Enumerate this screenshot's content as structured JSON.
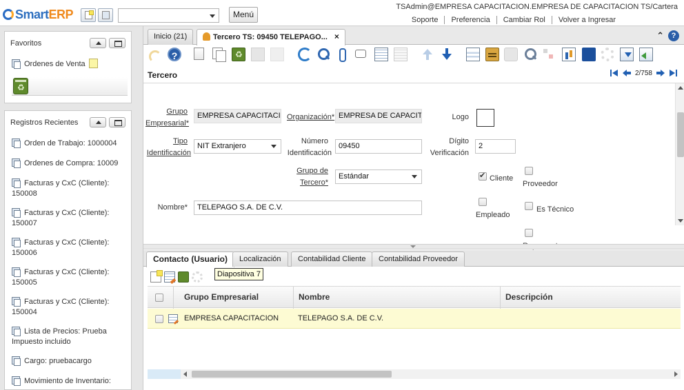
{
  "app": {
    "brand_prefix": "Smart",
    "brand_suffix": "ERP",
    "menu_label": "Menú",
    "combo_value": ""
  },
  "user": {
    "line": "TSAdmin@EMPRESA CAPACITACION.EMPRESA DE CAPACITACION TS/Cartera",
    "links": [
      "Soporte",
      "Preferencia",
      "Cambiar Rol",
      "Volver a Ingresar"
    ]
  },
  "favorites": {
    "title": "Favoritos",
    "items": [
      "Ordenes de Venta"
    ]
  },
  "recent": {
    "title": "Registros Recientes",
    "items": [
      "Orden de Trabajo: 1000004",
      "Ordenes de Compra: 10009",
      "Facturas y CxC (Cliente): 150008",
      "Facturas y CxC (Cliente): 150007",
      "Facturas y CxC (Cliente): 150006",
      "Facturas y CxC (Cliente): 150005",
      "Facturas y CxC (Cliente): 150004",
      "Lista de Precios: Prueba Impuesto incluido",
      "Cargo: pruebacargo",
      "Movimiento de Inventario:"
    ]
  },
  "window_tabs": [
    {
      "label": "Inicio (21)"
    },
    {
      "label": "Tercero TS: 09450 TELEPAGO...",
      "close": "×"
    }
  ],
  "form": {
    "title": "Tercero",
    "record_counter": "2/758",
    "labels": {
      "grupo_empresarial_1": "Grupo",
      "grupo_empresarial_2": "Empresarial*",
      "organizacion": "Organización*",
      "logo": "Logo",
      "tipo_id_1": "Tipo",
      "tipo_id_2": "Identificación",
      "numero_id_1": "Número",
      "numero_id_2": "Identificación",
      "digito_1": "Dígito",
      "digito_2": "Verificación",
      "grupo_tercero_1": "Grupo de",
      "grupo_tercero_2": "Tercero*",
      "nombre": "Nombre*",
      "cliente": "Cliente",
      "proveedor": "Proveedor",
      "empleado": "Empleado",
      "es_tecnico": "Es Técnico",
      "cut_label": "Represent"
    },
    "values": {
      "grupo_empresarial": "EMPRESA CAPACITACIO",
      "organizacion": "EMPRESA DE CAPACITA",
      "tipo_id": "NIT Extranjero",
      "numero_id": "09450",
      "digito": "2",
      "grupo_tercero": "Estándar",
      "nombre": "TELEPAGO S.A. DE C.V."
    },
    "checks": {
      "cliente": true,
      "proveedor": false,
      "empleado": false,
      "es_tecnico": false,
      "represent": false
    }
  },
  "subtabs": [
    "Contacto (Usuario)",
    "Localización",
    "Contabilidad Cliente",
    "Contabilidad Proveedor"
  ],
  "tooltip": "Diapositiva 7",
  "grid": {
    "columns": [
      "Grupo Empresarial",
      "Nombre",
      "Descripción"
    ],
    "rows": [
      {
        "grupo": "EMPRESA CAPACITACION",
        "nombre": "TELEPAGO S.A. DE C.V.",
        "descripcion": ""
      }
    ]
  },
  "icons": {
    "help": "?",
    "collapse": "⌃"
  }
}
